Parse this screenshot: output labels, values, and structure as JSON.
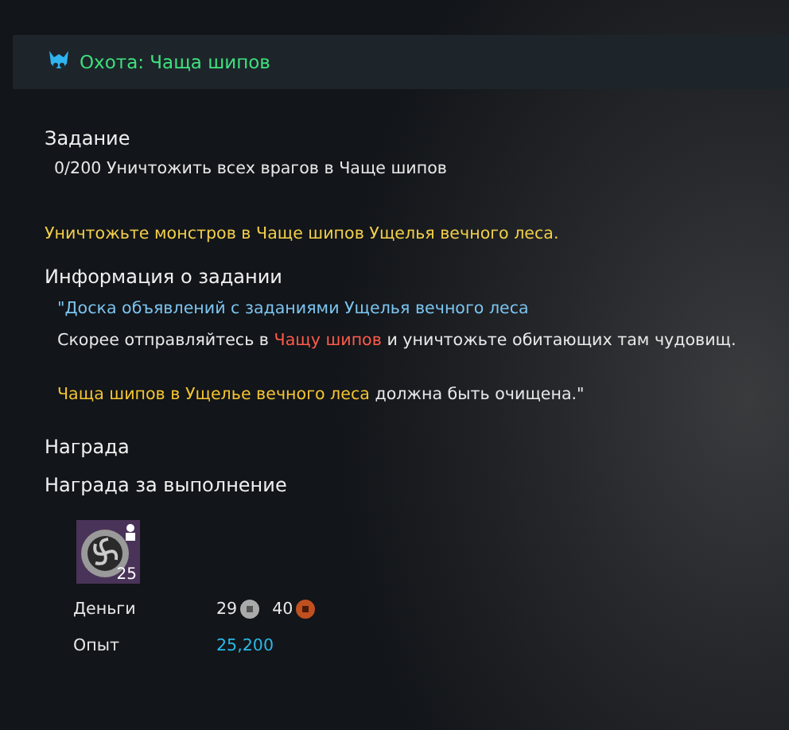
{
  "header": {
    "title": "Охота: Чаща шипов"
  },
  "task": {
    "heading": "Задание",
    "objectives": [
      {
        "text": "0/200 Уничтожить всех врагов в Чаще шипов"
      }
    ],
    "summary": "Уничтожьте монстров в Чаще шипов Ущелья вечного леса."
  },
  "info": {
    "heading": "Информация о задании",
    "paragraphs": [
      {
        "lines": [
          [
            {
              "kind": "source",
              "text": "\"Доска объявлений с заданиями Ущелья вечного леса"
            }
          ],
          [
            {
              "kind": "plain",
              "text": "Скорее отправляйтесь в "
            },
            {
              "kind": "place",
              "text": "Чащу шипов"
            },
            {
              "kind": "plain",
              "text": " и уничтожьте обитающих там чудовищ."
            }
          ]
        ]
      },
      {
        "lines": [
          [
            {
              "kind": "highlight",
              "text": "Чаща шипов в Ущелье вечного леса"
            },
            {
              "kind": "plain",
              "text": " должна быть очищена.\""
            }
          ]
        ]
      }
    ]
  },
  "reward": {
    "heading": "Награда",
    "subheading": "Награда за выполнение",
    "item": {
      "count": "25"
    },
    "rows": [
      {
        "kind": "money",
        "label": "Деньги",
        "silver": "29",
        "copper": "40"
      },
      {
        "kind": "exp",
        "label": "Опыт",
        "value": "25,200"
      }
    ]
  }
}
